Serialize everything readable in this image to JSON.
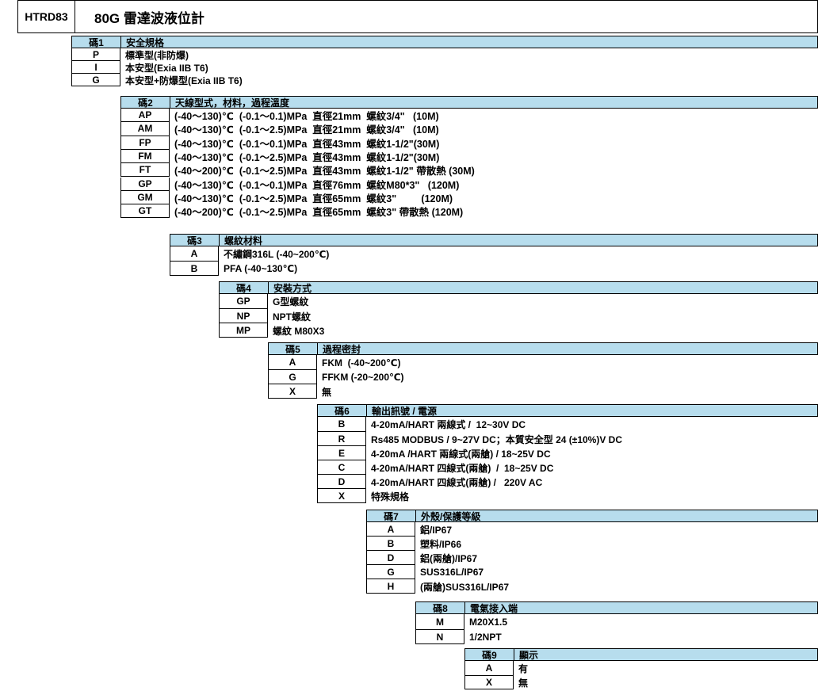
{
  "header": {
    "model_code": "HTRD83",
    "title": "80G 雷達波液位計"
  },
  "sections": [
    {
      "code_header": "碼1",
      "title": "安全規格",
      "rows": [
        {
          "code": "P",
          "desc": "標準型(非防爆)"
        },
        {
          "code": "I",
          "desc": "本安型(Exia IIB T6)"
        },
        {
          "code": "G",
          "desc": "本安型+防爆型(Exia IIB T6)"
        }
      ]
    },
    {
      "code_header": "碼2",
      "title": "天線型式，材料，過程溫度",
      "rows": [
        {
          "code": "AP",
          "desc": "(-40～130)℃  (-0.1～0.1)MPa  直徑21mm  螺紋3/4\"   (10M)"
        },
        {
          "code": "AM",
          "desc": "(-40～130)℃  (-0.1～2.5)MPa  直徑21mm  螺紋3/4\"   (10M)"
        },
        {
          "code": "FP",
          "desc": "(-40～130)℃  (-0.1～0.1)MPa  直徑43mm  螺紋1-1/2\"(30M)"
        },
        {
          "code": "FM",
          "desc": "(-40～130)℃  (-0.1～2.5)MPa  直徑43mm  螺紋1-1/2\"(30M)"
        },
        {
          "code": "FT",
          "desc": "(-40～200)℃  (-0.1～2.5)MPa  直徑43mm  螺紋1-1/2\" 帶散熱 (30M)"
        },
        {
          "code": "GP",
          "desc": "(-40～130)℃  (-0.1～0.1)MPa  直徑76mm  螺紋M80*3\"   (120M)"
        },
        {
          "code": "GM",
          "desc": "(-40～130)℃  (-0.1～2.5)MPa  直徑65mm  螺紋3\"         (120M)"
        },
        {
          "code": "GT",
          "desc": "(-40～200)℃  (-0.1～2.5)MPa  直徑65mm  螺紋3\" 帶散熱 (120M)"
        }
      ]
    },
    {
      "code_header": "碼3",
      "title": "螺紋材料",
      "rows": [
        {
          "code": "A",
          "desc": "不繡鋼316L (-40~200℃)"
        },
        {
          "code": "B",
          "desc": "PFA (-40~130℃)"
        }
      ]
    },
    {
      "code_header": "碼4",
      "title": "安裝方式",
      "rows": [
        {
          "code": "GP",
          "desc": "G型螺紋"
        },
        {
          "code": "NP",
          "desc": "NPT螺紋"
        },
        {
          "code": "MP",
          "desc": "螺紋 M80X3"
        }
      ]
    },
    {
      "code_header": "碼5",
      "title": "過程密封",
      "rows": [
        {
          "code": "A",
          "desc": "FKM  (-40~200℃)"
        },
        {
          "code": "G",
          "desc": "FFKM (-20~200℃)"
        },
        {
          "code": "X",
          "desc": "無"
        }
      ]
    },
    {
      "code_header": "碼6",
      "title": "輸出訊號 / 電源",
      "rows": [
        {
          "code": "B",
          "desc": "4-20mA/HART 兩線式 /  12~30V DC"
        },
        {
          "code": "R",
          "desc": "Rs485 MODBUS / 9~27V DC；本質安全型 24 (±10%)V DC"
        },
        {
          "code": "E",
          "desc": "4-20mA /HART 兩線式(兩艙) / 18~25V DC"
        },
        {
          "code": "C",
          "desc": "4-20mA/HART 四線式(兩艙)  /  18~25V DC"
        },
        {
          "code": "D",
          "desc": "4-20mA/HART 四線式(兩艙) /   220V AC"
        },
        {
          "code": "X",
          "desc": "特殊規格"
        }
      ]
    },
    {
      "code_header": "碼7",
      "title": "外殼/保護等級",
      "rows": [
        {
          "code": "A",
          "desc": "鋁/IP67"
        },
        {
          "code": "B",
          "desc": "塑料/IP66"
        },
        {
          "code": "D",
          "desc": "鋁(兩艙)/IP67"
        },
        {
          "code": "G",
          "desc": "SUS316L/IP67"
        },
        {
          "code": "H",
          "desc": "(兩艙)SUS316L/IP67"
        }
      ]
    },
    {
      "code_header": "碼8",
      "title": "電氣接入端",
      "rows": [
        {
          "code": "M",
          "desc": "M20X1.5"
        },
        {
          "code": "N",
          "desc": "1/2NPT"
        }
      ]
    },
    {
      "code_header": "碼9",
      "title": "顯示",
      "rows": [
        {
          "code": "A",
          "desc": "有"
        },
        {
          "code": "X",
          "desc": "無"
        }
      ]
    }
  ]
}
